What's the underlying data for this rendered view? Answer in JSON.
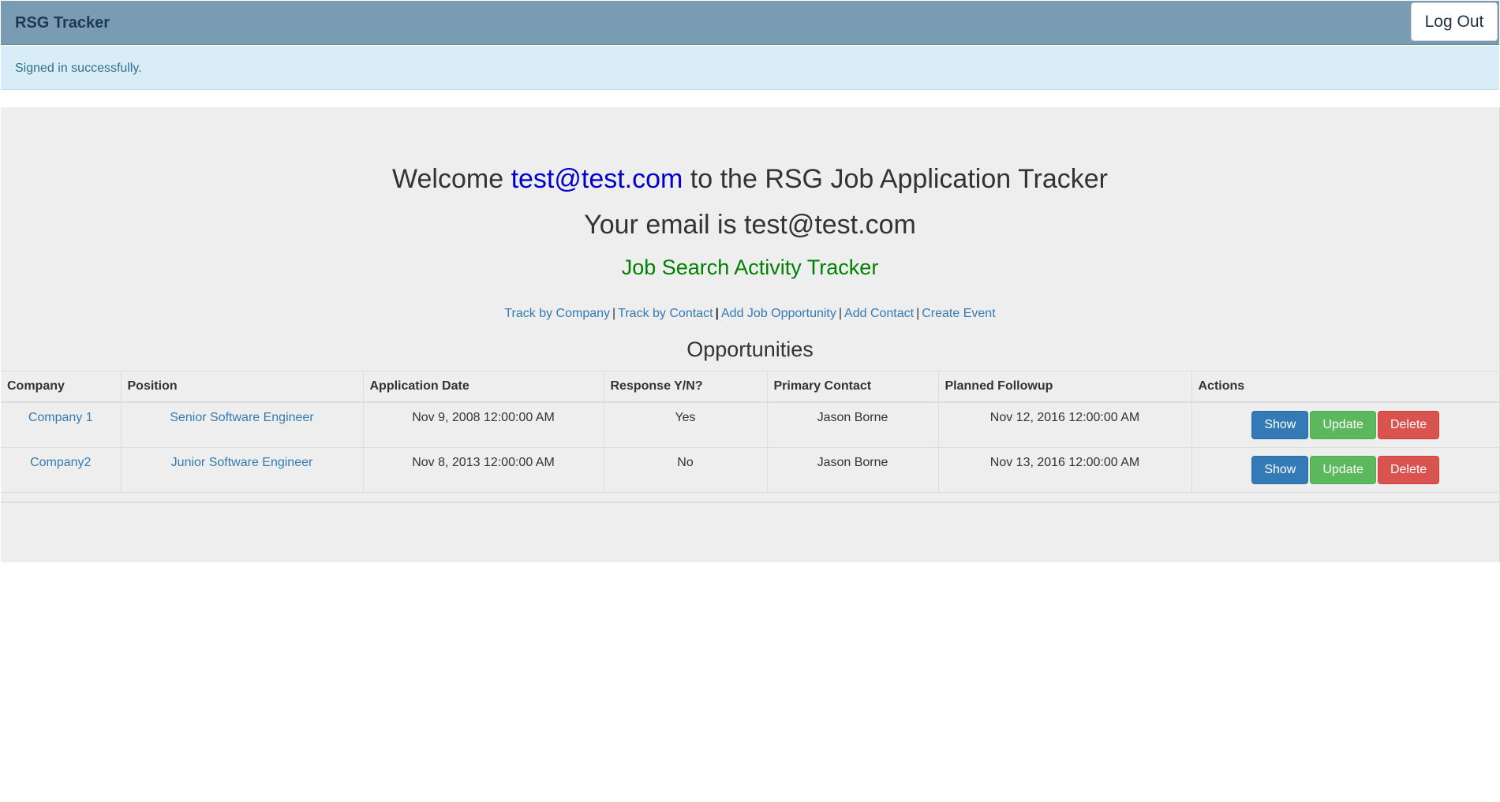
{
  "navbar": {
    "brand": "RSG Tracker",
    "logout_label": "Log Out"
  },
  "alert": {
    "message": "Signed in successfully."
  },
  "main": {
    "welcome_prefix": "Welcome ",
    "welcome_email": "test@test.com",
    "welcome_suffix": " to the RSG Job Application Tracker",
    "your_email": "Your email is test@test.com",
    "tracker_title": "Job Search Activity Tracker",
    "links": {
      "track_by_company": "Track by Company",
      "track_by_contact": "Track by Contact",
      "add_job_opportunity": "Add Job Opportunity",
      "add_contact": "Add Contact",
      "create_event": "Create Event",
      "separator": "|"
    },
    "opportunities_title": "Opportunities",
    "colors": {
      "email_link": "#0000cc",
      "tracker_title": "#008000",
      "link": "#337ab7",
      "show_button": "#337ab7",
      "update_button": "#5cb85c",
      "delete_button": "#d9534f"
    }
  },
  "table": {
    "headers": {
      "company": "Company",
      "position": "Position",
      "application_date": "Application Date",
      "response": "Response Y/N?",
      "primary_contact": "Primary Contact",
      "planned_followup": "Planned Followup",
      "actions": "Actions"
    },
    "rows": [
      {
        "company": "Company 1",
        "position": "Senior Software Engineer",
        "application_date": "Nov 9, 2008 12:00:00 AM",
        "response": "Yes",
        "primary_contact": "Jason Borne",
        "planned_followup": "Nov 12, 2016 12:00:00 AM"
      },
      {
        "company": "Company2",
        "position": "Junior Software Engineer",
        "application_date": "Nov 8, 2013 12:00:00 AM",
        "response": "No",
        "primary_contact": "Jason Borne",
        "planned_followup": "Nov 13, 2016 12:00:00 AM"
      }
    ],
    "actions": {
      "show": "Show",
      "update": "Update",
      "delete": "Delete"
    }
  }
}
